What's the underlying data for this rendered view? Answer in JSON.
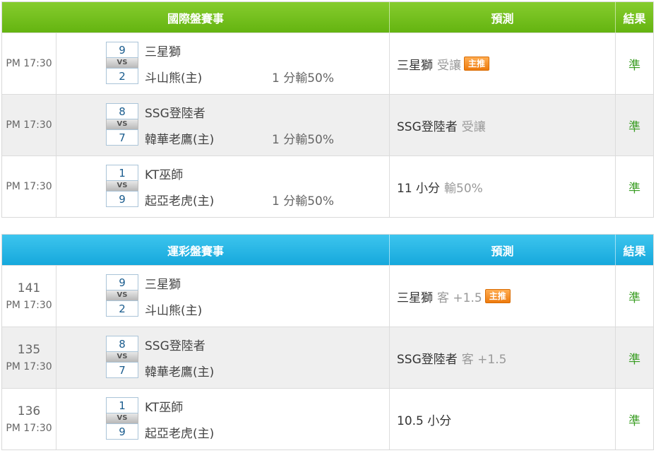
{
  "international": {
    "header": {
      "match": "國際盤賽事",
      "prediction": "預測",
      "result": "結果"
    },
    "rows": [
      {
        "time": "PM 17:30",
        "top_score": "9",
        "bottom_score": "2",
        "vs": "VS",
        "top_team": "三星獅",
        "bottom_team": "斗山熊(主)",
        "handicap": "1 分輸50%",
        "pick": "三星獅",
        "pick_sub": "受讓",
        "badge": "主推",
        "result": "準"
      },
      {
        "time": "PM 17:30",
        "top_score": "8",
        "bottom_score": "7",
        "vs": "VS",
        "top_team": "SSG登陸者",
        "bottom_team": "韓華老鷹(主)",
        "handicap": "1 分輸50%",
        "pick": "SSG登陸者",
        "pick_sub": "受讓",
        "badge": "",
        "result": "準"
      },
      {
        "time": "PM 17:30",
        "top_score": "1",
        "bottom_score": "9",
        "vs": "VS",
        "top_team": "KT巫師",
        "bottom_team": "起亞老虎(主)",
        "handicap": "1 分輸50%",
        "pick": "11 小分",
        "pick_sub": "輸50%",
        "badge": "",
        "result": "準"
      }
    ]
  },
  "sports_lottery": {
    "header": {
      "match": "運彩盤賽事",
      "prediction": "預測",
      "result": "結果"
    },
    "rows": [
      {
        "number": "141",
        "time": "PM 17:30",
        "top_score": "9",
        "bottom_score": "2",
        "vs": "VS",
        "top_team": "三星獅",
        "bottom_team": "斗山熊(主)",
        "pick": "三星獅",
        "pick_sub": "客 +1.5",
        "badge": "主推",
        "result": "準"
      },
      {
        "number": "135",
        "time": "PM 17:30",
        "top_score": "8",
        "bottom_score": "7",
        "vs": "VS",
        "top_team": "SSG登陸者",
        "bottom_team": "韓華老鷹(主)",
        "pick": "SSG登陸者",
        "pick_sub": "客 +1.5",
        "badge": "",
        "result": "準"
      },
      {
        "number": "136",
        "time": "PM 17:30",
        "top_score": "1",
        "bottom_score": "9",
        "vs": "VS",
        "top_team": "KT巫師",
        "bottom_team": "起亞老虎(主)",
        "pick": "10.5 小分",
        "pick_sub": "",
        "badge": "",
        "result": "準"
      }
    ]
  },
  "colors": {
    "green_header": "#64b410",
    "blue_header": "#16a8dc",
    "result_green": "#3a9d23",
    "badge_orange": "#ee7b0e"
  }
}
